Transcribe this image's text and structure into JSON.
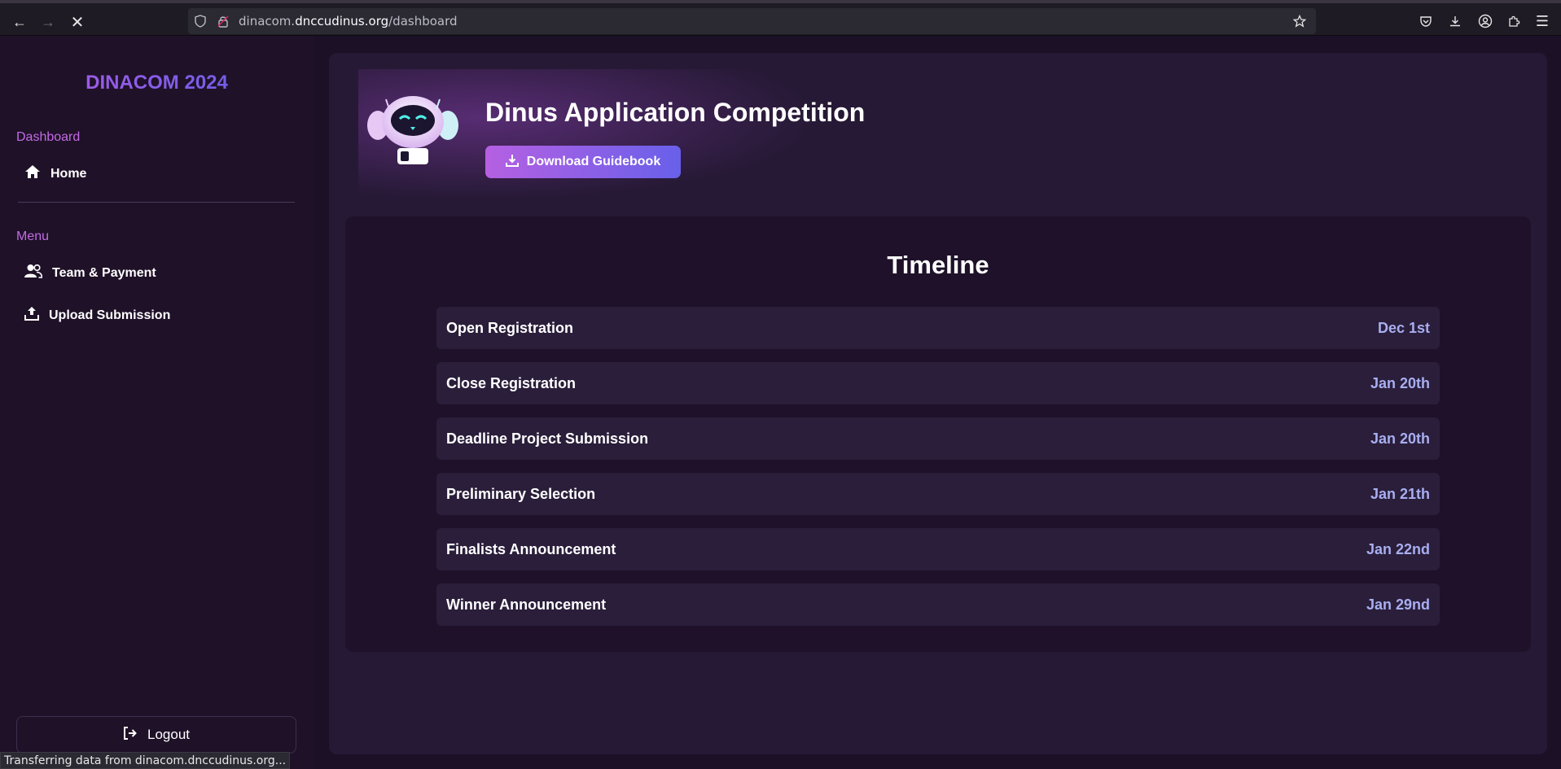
{
  "browser": {
    "url_prefix": "dinacom.",
    "url_host": "dnccudinus.org",
    "url_path": "/dashboard",
    "status_text": "Transferring data from dinacom.dnccudinus.org..."
  },
  "sidebar": {
    "brand": "DINACOM 2024",
    "dashboard_label": "Dashboard",
    "home_label": "Home",
    "menu_label": "Menu",
    "items": [
      {
        "label": "Team & Payment",
        "icon": "users-icon"
      },
      {
        "label": "Upload Submission",
        "icon": "upload-icon"
      }
    ],
    "logout_label": "Logout"
  },
  "hero": {
    "title": "Dinus Application Competition",
    "download_label": "Download Guidebook"
  },
  "timeline": {
    "title": "Timeline",
    "rows": [
      {
        "label": "Open Registration",
        "date": "Dec 1st"
      },
      {
        "label": "Close Registration",
        "date": "Jan 20th"
      },
      {
        "label": "Deadline Project Submission",
        "date": "Jan 20th"
      },
      {
        "label": "Preliminary Selection",
        "date": "Jan 21th"
      },
      {
        "label": "Finalists Announcement",
        "date": "Jan 22nd"
      },
      {
        "label": "Winner Announcement",
        "date": "Jan 29nd"
      }
    ]
  },
  "colors": {
    "accent_purple": "#c36be6",
    "accent_blue": "#6860ea",
    "date_color": "#a8aef0"
  }
}
